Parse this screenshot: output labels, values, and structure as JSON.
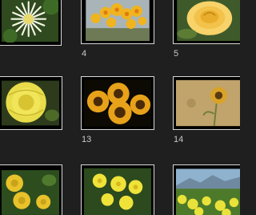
{
  "gallery": {
    "items": [
      {
        "label": "",
        "thumbnail": "white-daisy-flower-icon"
      },
      {
        "label": "4",
        "thumbnail": "yellow-daffodils-icon"
      },
      {
        "label": "5",
        "thumbnail": "yellow-rose-icon"
      },
      {
        "label": "",
        "thumbnail": "yellow-dahlia-icon"
      },
      {
        "label": "13",
        "thumbnail": "sunflowers-icon"
      },
      {
        "label": "14",
        "thumbnail": "sunflower-painting-icon"
      },
      {
        "label": "",
        "thumbnail": "yellow-dahlias-field-icon"
      },
      {
        "label": "",
        "thumbnail": "yellow-primroses-icon"
      },
      {
        "label": "",
        "thumbnail": "yellow-flowers-landscape-icon"
      }
    ]
  },
  "colors": {
    "background": "#1f1f1f",
    "tile_border": "#d8d8d8",
    "label_text": "#c8c8c8"
  }
}
